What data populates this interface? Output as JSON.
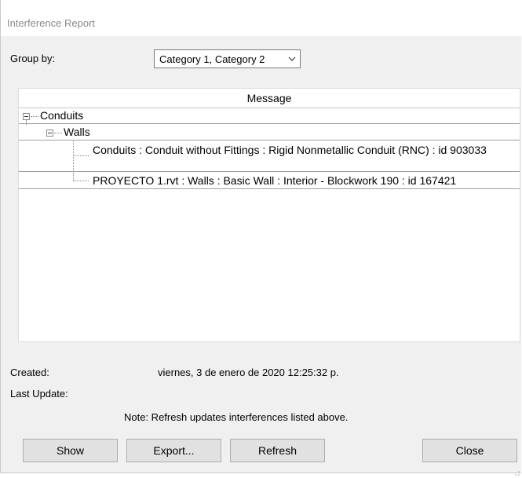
{
  "window": {
    "title": "Interference Report"
  },
  "group_by": {
    "label": "Group by:",
    "value": "Category 1, Category 2"
  },
  "grid": {
    "header": "Message",
    "tree": {
      "group": "Conduits",
      "subgroup": "Walls",
      "items": [
        "Conduits : Conduit without Fittings : Rigid Nonmetallic Conduit (RNC) : id 903033",
        "PROYECTO 1.rvt : Walls : Basic Wall : Interior - Blockwork 190 : id 167421"
      ]
    }
  },
  "info": {
    "created_label": "Created:",
    "created_value": "viernes, 3 de enero de 2020 12:25:32 p.",
    "last_update_label": "Last Update:",
    "last_update_value": "",
    "note": "Note: Refresh updates interferences listed above."
  },
  "buttons": {
    "show": "Show",
    "export": "Export...",
    "refresh": "Refresh",
    "close": "Close"
  }
}
